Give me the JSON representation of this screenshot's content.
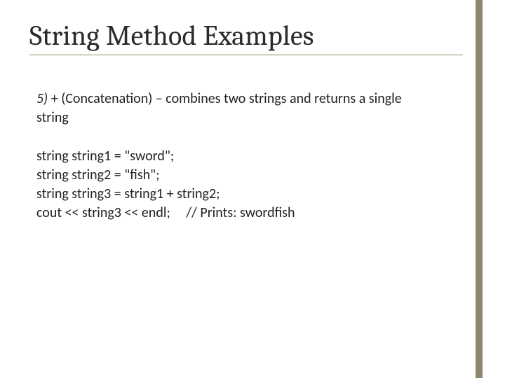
{
  "title": "String Method Examples",
  "desc_lead": "5)",
  "desc_rest": " +  (Concatenation) – combines two strings and returns a single string",
  "code": {
    "l1": "string string1 = \"sword\";",
    "l2": "string string2 = \"fish\";",
    "l3": "string string3 = string1 + string2;",
    "l4": "cout << string3 << endl;     // Prints: swordfish"
  }
}
